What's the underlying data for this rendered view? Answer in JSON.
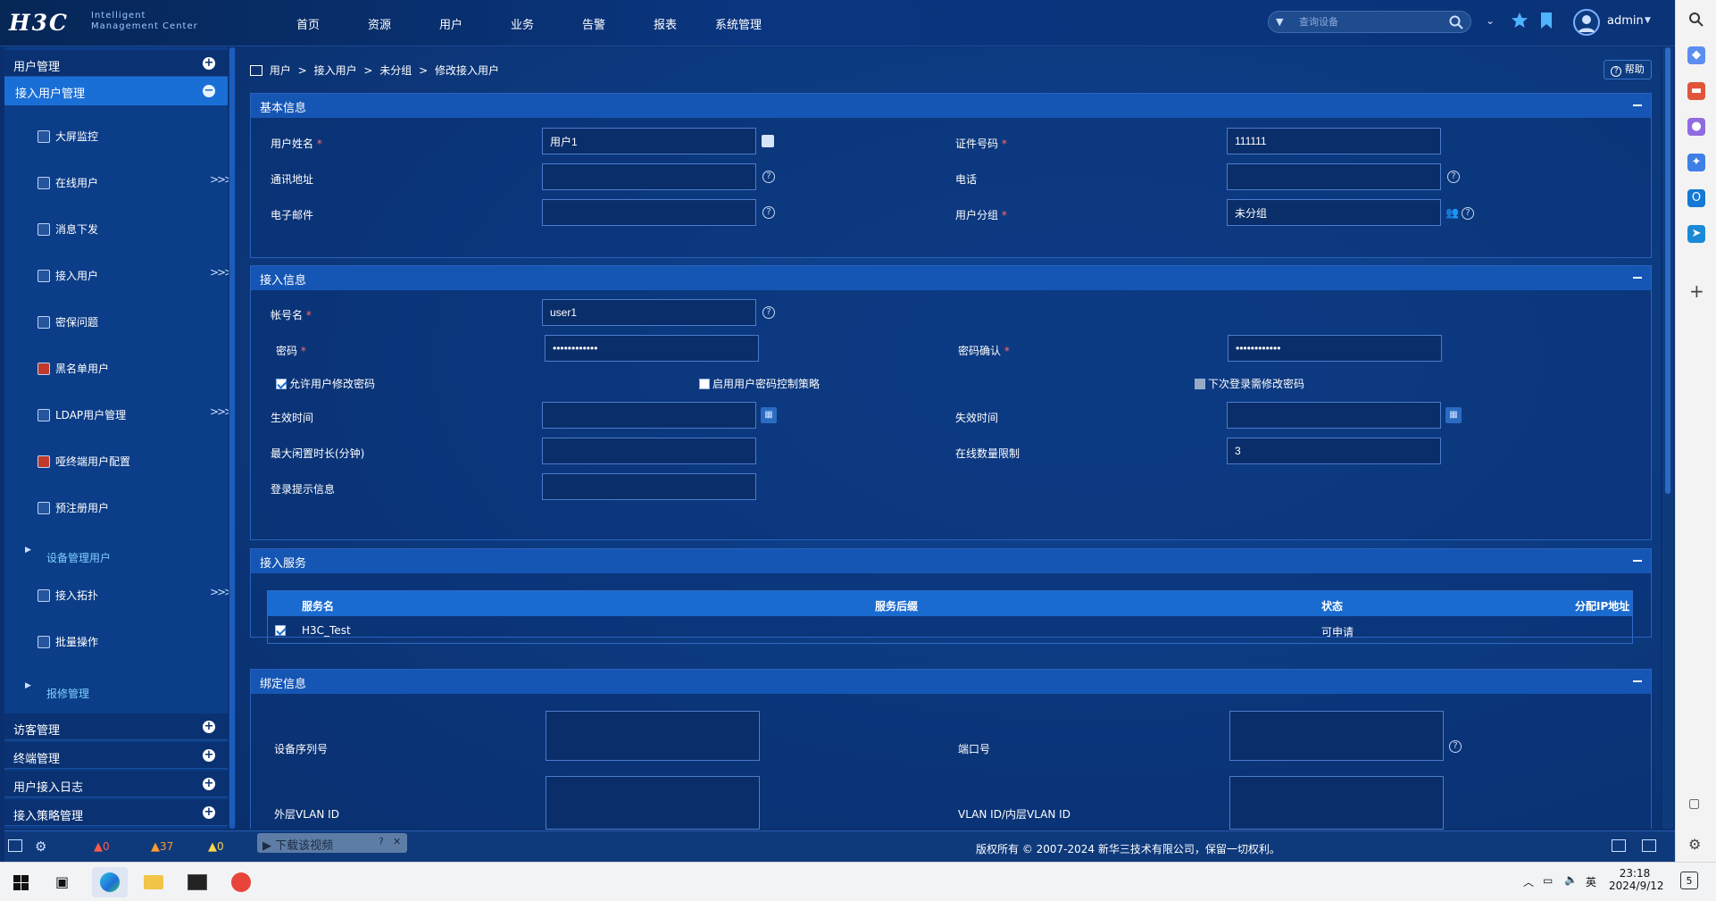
{
  "topbar": {
    "brand": "H3C",
    "brand_sub1": "Intelligent",
    "brand_sub2": "Management Center",
    "nav": [
      "首页",
      "资源",
      "用户",
      "业务",
      "告警",
      "报表",
      "系统管理"
    ],
    "search_placeholder": "查询设备",
    "user": "admin"
  },
  "sidebar": {
    "sections_top": [
      "用户管理"
    ],
    "active_section": "接入用户管理",
    "items": [
      {
        "label": "大屏监控",
        "arrow": ""
      },
      {
        "label": "在线用户",
        "arrow": ">>>"
      },
      {
        "label": "消息下发",
        "arrow": ""
      },
      {
        "label": "接入用户",
        "arrow": ">>>"
      },
      {
        "label": "密保问题",
        "arrow": ""
      },
      {
        "label": "黑名单用户",
        "arrow": ""
      },
      {
        "label": "LDAP用户管理",
        "arrow": ">>>"
      },
      {
        "label": "哑终端用户配置",
        "arrow": ""
      },
      {
        "label": "预注册用户",
        "arrow": ""
      }
    ],
    "link1": "设备管理用户",
    "items2": [
      {
        "label": "接入拓扑",
        "arrow": ">>>"
      },
      {
        "label": "批量操作",
        "arrow": ""
      }
    ],
    "link2": "报修管理",
    "sections_bottom": [
      "访客管理",
      "终端管理",
      "用户接入日志",
      "接入策略管理"
    ]
  },
  "breadcrumb": {
    "parts": [
      "用户",
      ">",
      "接入用户",
      ">",
      "未分组",
      ">",
      "修改接入用户"
    ],
    "help": "帮助"
  },
  "basic": {
    "title": "基本信息",
    "user_name_label": "用户姓名",
    "user_name_value": "用户1",
    "id_label": "证件号码",
    "id_value": "111111",
    "address_label": "通讯地址",
    "phone_label": "电话",
    "email_label": "电子邮件",
    "group_label": "用户分组",
    "group_value": "未分组",
    "required": "*",
    "help_mark": "?"
  },
  "access": {
    "title": "接入信息",
    "account_label": "帐号名",
    "account_value": "user1",
    "password_label": "密码",
    "password_value": "••••••••••••",
    "confirm_label": "密码确认",
    "confirm_value": "••••••••••••",
    "cb_allow": "允许用户修改密码",
    "cb_policy": "启用用户密码控制策略",
    "cb_next": "下次登录需修改密码",
    "effective_label": "生效时间",
    "expire_label": "失效时间",
    "idle_label": "最大闲置时长(分钟)",
    "online_limit_label": "在线数量限制",
    "online_limit_value": "3",
    "login_tip_label": "登录提示信息"
  },
  "service": {
    "title": "接入服务",
    "headers": [
      "服务名",
      "服务后缀",
      "状态",
      "分配IP地址"
    ],
    "rows": [
      {
        "name": "H3C_Test",
        "suffix": "",
        "status": "可申请",
        "ip": ""
      }
    ]
  },
  "binding": {
    "title": "绑定信息",
    "serial_label": "设备序列号",
    "port_label": "端口号",
    "outer_vlan_label": "外层VLAN ID",
    "inner_vlan_label": "VLAN ID/内层VLAN ID"
  },
  "statusbar": {
    "crit": "0",
    "major": "37",
    "minor": "0",
    "floating": "下载该视频",
    "copyright": "版权所有 © 2007-2024 新华三技术有限公司，保留一切权利。"
  },
  "taskbar": {
    "time": "23:18",
    "date": "2024/9/12",
    "ime": "英",
    "notif": "5"
  }
}
